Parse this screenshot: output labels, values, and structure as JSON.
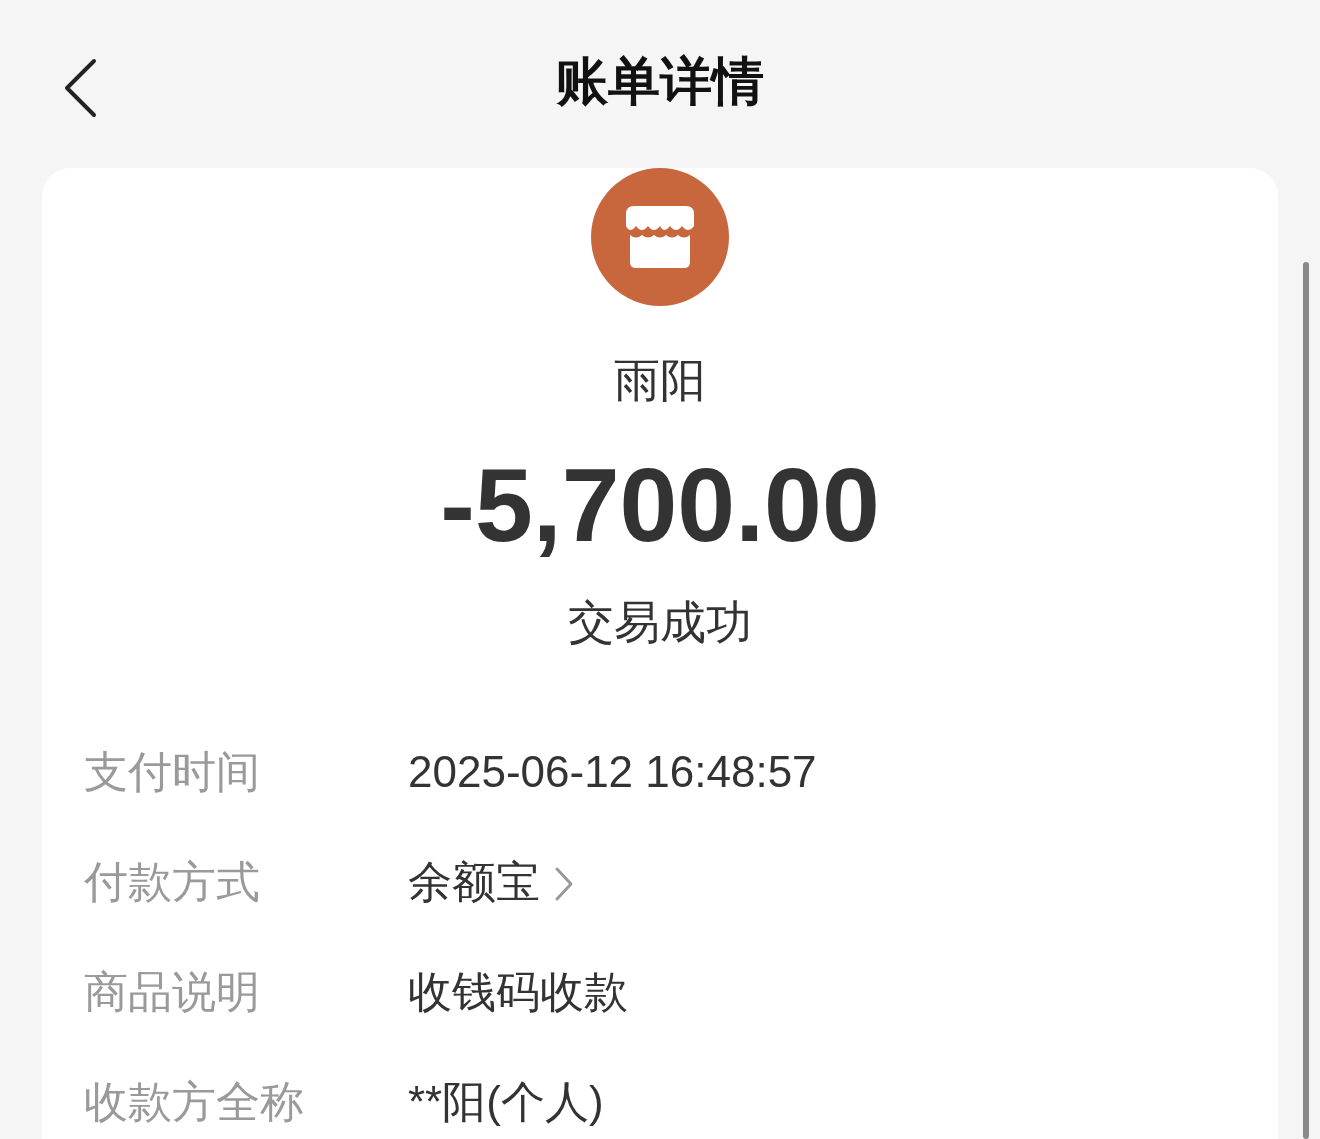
{
  "header": {
    "title": "账单详情"
  },
  "payee": {
    "name": "雨阳",
    "amount": "-5,700.00",
    "status": "交易成功"
  },
  "details": [
    {
      "kind": "text",
      "label": "支付时间",
      "value": "2025-06-12 16:48:57"
    },
    {
      "kind": "link",
      "label": "付款方式",
      "value": "余额宝"
    },
    {
      "kind": "text",
      "label": "商品说明",
      "value": "收钱码收款"
    },
    {
      "kind": "text",
      "label": "收款方全称",
      "value": "**阳(个人)"
    }
  ]
}
